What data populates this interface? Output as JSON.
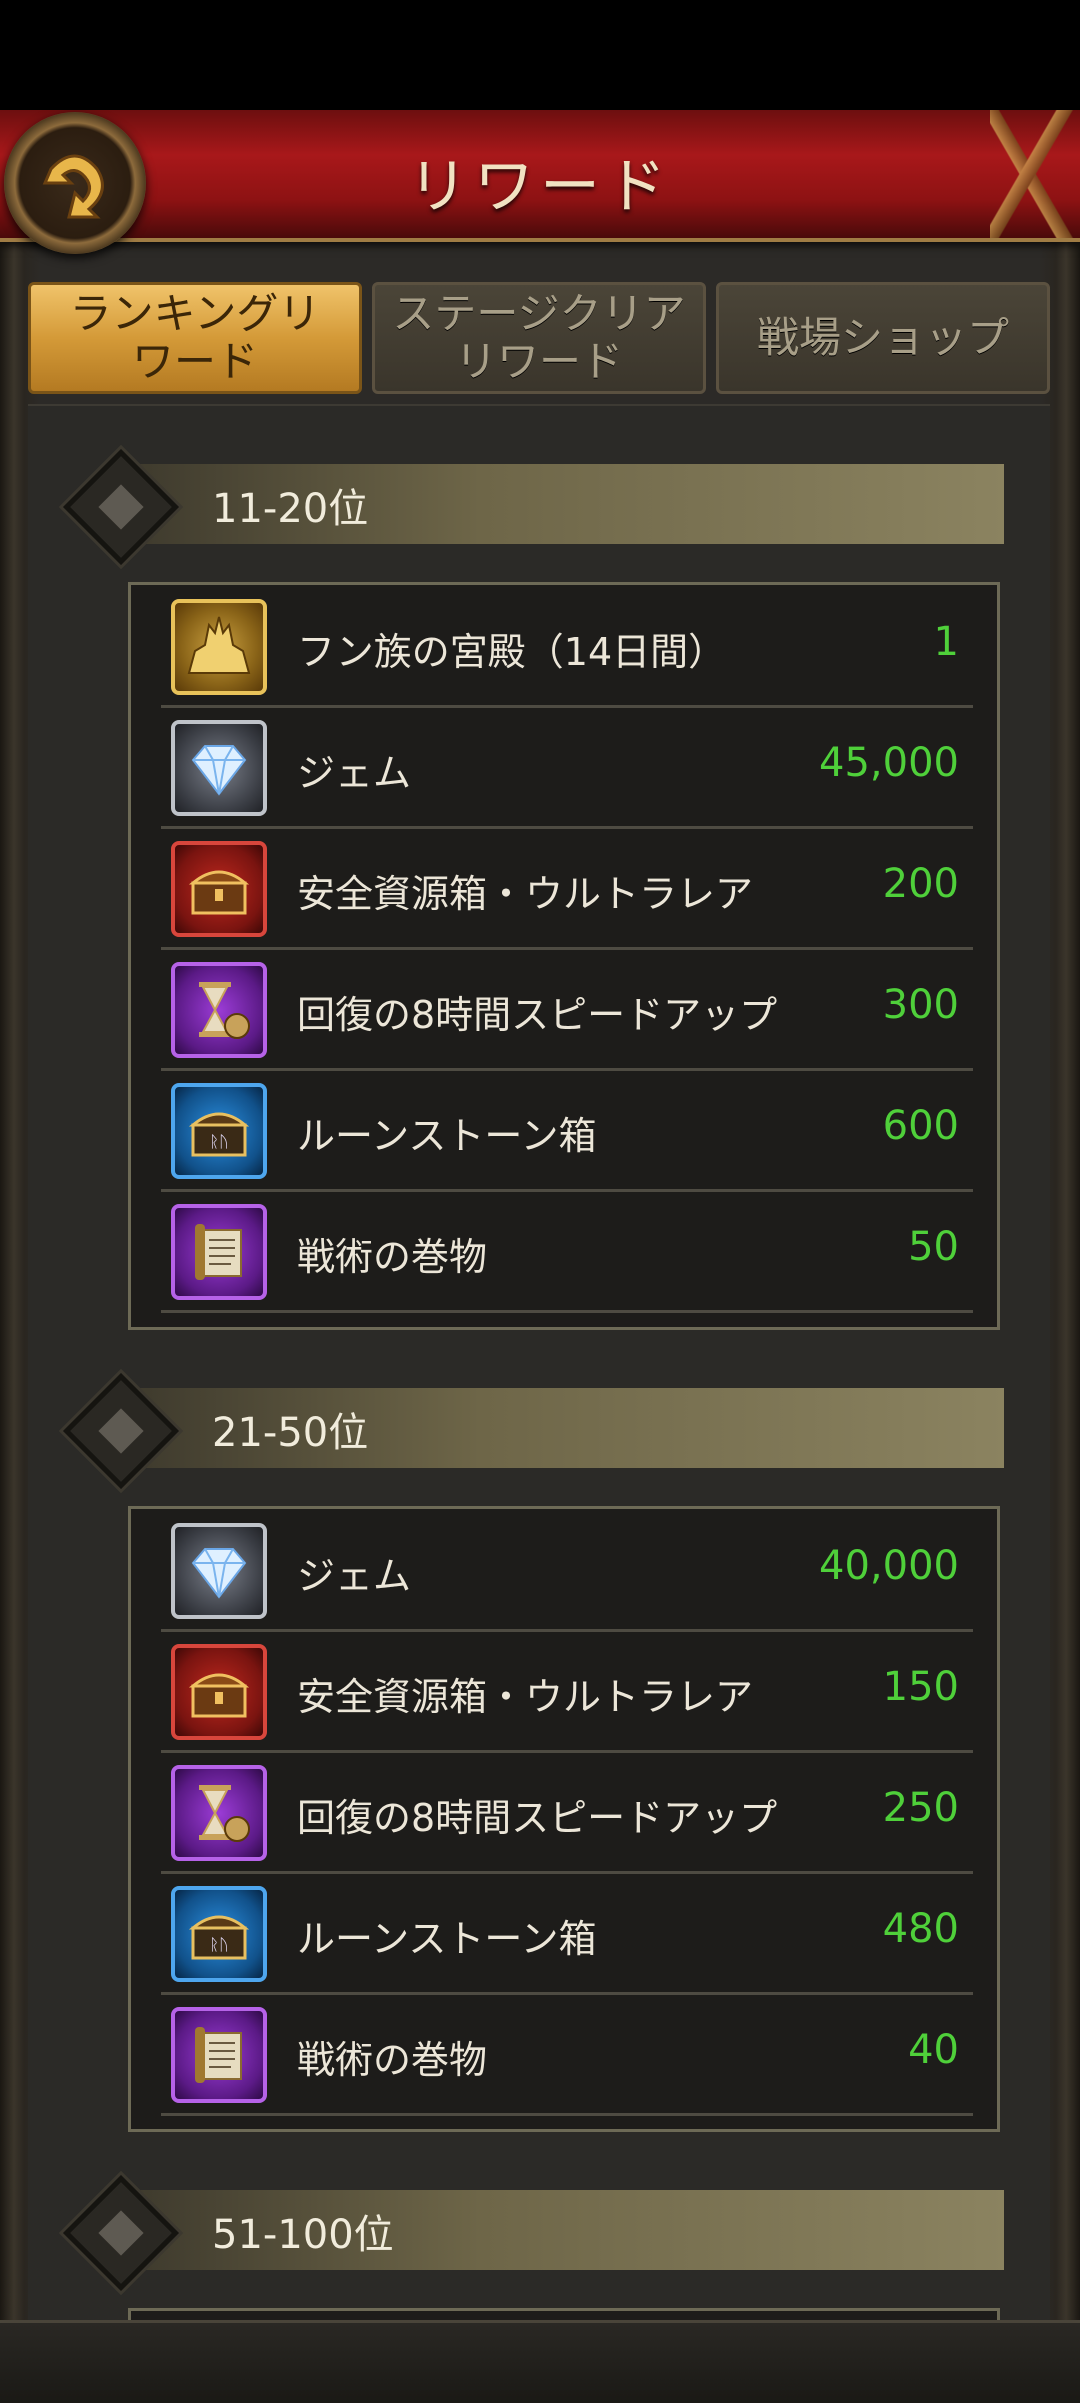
{
  "header": {
    "title": "リワード"
  },
  "tabs": [
    {
      "label": "ランキングリワード",
      "active": true
    },
    {
      "label": "ステージクリアリワード",
      "active": false
    },
    {
      "label": "戦場ショップ",
      "active": false
    }
  ],
  "sections": [
    {
      "label": "11-20位",
      "items": [
        {
          "name": "フン族の宮殿（14日間）",
          "qty": "1",
          "icon": "palace-icon"
        },
        {
          "name": "ジェム",
          "qty": "45,000",
          "icon": "gem-icon"
        },
        {
          "name": "安全資源箱・ウルトラレア",
          "qty": "200",
          "icon": "resource-chest-icon"
        },
        {
          "name": "回復の8時間スピードアップ",
          "qty": "300",
          "icon": "hourglass-icon"
        },
        {
          "name": "ルーンストーン箱",
          "qty": "600",
          "icon": "runestone-chest-icon"
        },
        {
          "name": "戦術の巻物",
          "qty": "50",
          "icon": "scroll-icon"
        }
      ]
    },
    {
      "label": "21-50位",
      "items": [
        {
          "name": "ジェム",
          "qty": "40,000",
          "icon": "gem-icon"
        },
        {
          "name": "安全資源箱・ウルトラレア",
          "qty": "150",
          "icon": "resource-chest-icon"
        },
        {
          "name": "回復の8時間スピードアップ",
          "qty": "250",
          "icon": "hourglass-icon"
        },
        {
          "name": "ルーンストーン箱",
          "qty": "480",
          "icon": "runestone-chest-icon"
        },
        {
          "name": "戦術の巻物",
          "qty": "40",
          "icon": "scroll-icon"
        }
      ]
    },
    {
      "label": "51-100位",
      "items": []
    }
  ],
  "colors": {
    "accent_gold": "#d49a38",
    "header_red": "#a8181a",
    "quantity_green": "#4fd03a"
  }
}
